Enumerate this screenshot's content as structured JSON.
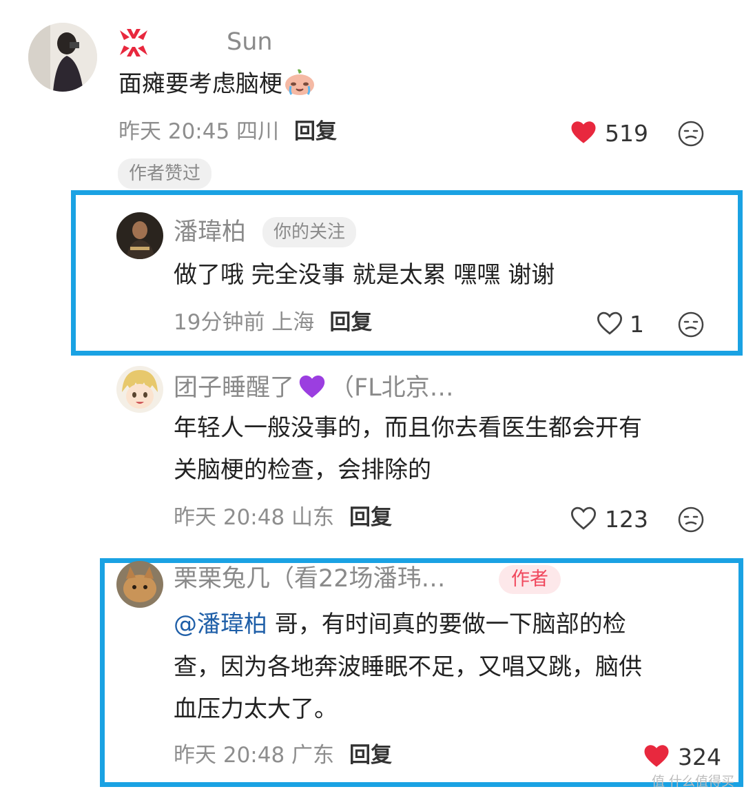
{
  "comment1": {
    "name": "Sun",
    "text": "面瘫要考虑脑梗",
    "time": "昨天 20:45 四川",
    "reply_label": "回复",
    "likes": "519",
    "liked": true,
    "badge": "作者赞过"
  },
  "reply1": {
    "name": "潘瑋柏",
    "tag": "你的关注",
    "text": "做了哦 完全没事 就是太累 嘿嘿 谢谢",
    "time": "19分钟前 上海",
    "reply_label": "回复",
    "likes": "1",
    "liked": false
  },
  "reply2": {
    "name_a": "团子睡醒了",
    "name_b": "（FL北京…",
    "text_line1": "年轻人一般没事的，而且你去看医生都会开有",
    "text_line2": "关脑梗的检查，会排除的",
    "time": "昨天 20:48 山东",
    "reply_label": "回复",
    "likes": "123",
    "liked": false
  },
  "reply3": {
    "name": "栗栗兔几（看22场潘玮…",
    "author_tag": "作者",
    "mention": "@潘瑋柏",
    "text_line1": " 哥，有时间真的要做一下脑部的检",
    "text_line2": "查，因为各地奔波睡眠不足，又唱又跳，脑供",
    "text_line3": "血压力太大了。",
    "time": "昨天 20:48 广东",
    "reply_label": "回复",
    "likes": "324",
    "liked": true
  },
  "watermark": "值 什么值得买",
  "colors": {
    "highlight": "#1aa2e3",
    "like_red": "#e8283e",
    "mention": "#1f5fa8",
    "author_pink": "#f0485d"
  }
}
